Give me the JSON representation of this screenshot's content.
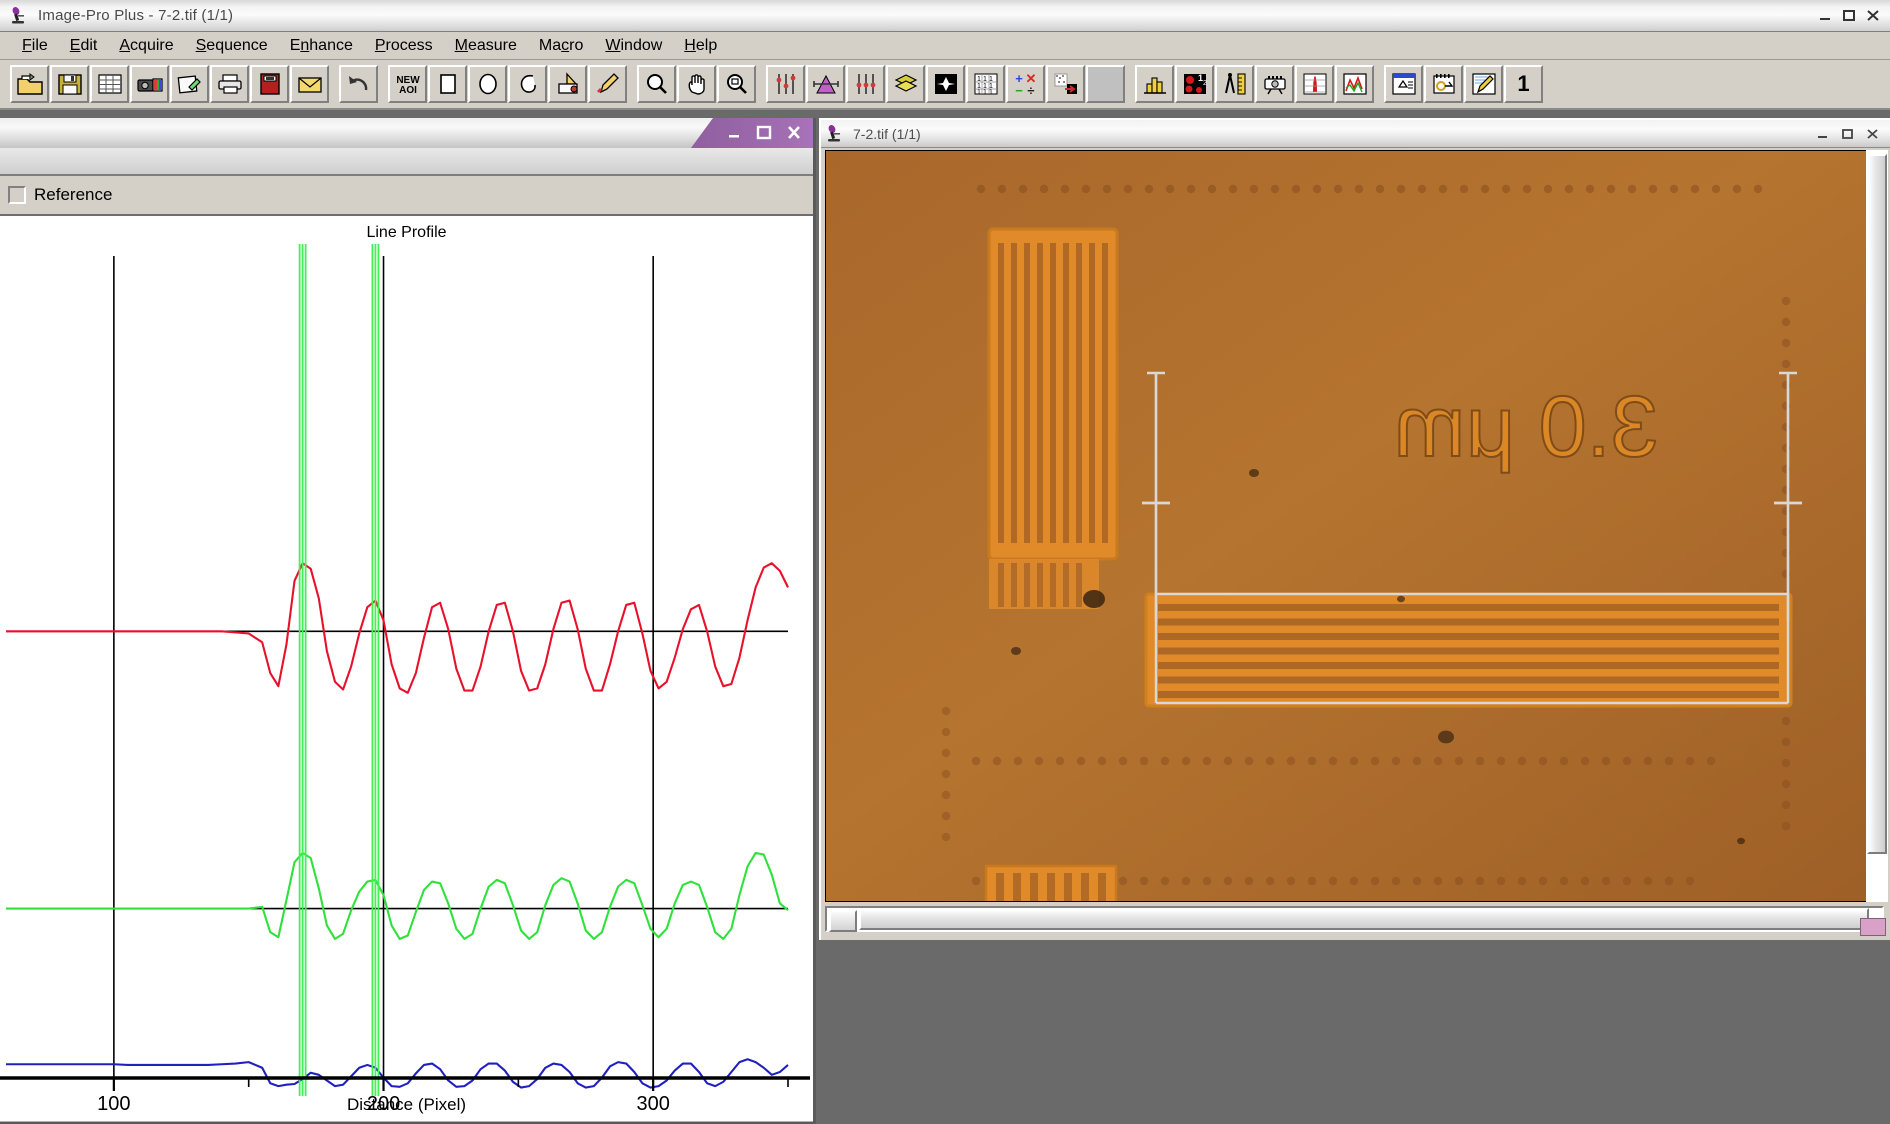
{
  "app": {
    "title": "Image-Pro Plus - 7-2.tif (1/1)",
    "icon": "microscope-icon",
    "window_controls": {
      "minimize": "–",
      "maximize": "□",
      "close": "✕"
    }
  },
  "menubar": {
    "items": [
      {
        "label": "File",
        "accel": "F"
      },
      {
        "label": "Edit",
        "accel": "E"
      },
      {
        "label": "Acquire",
        "accel": "A"
      },
      {
        "label": "Sequence",
        "accel": "S"
      },
      {
        "label": "Enhance",
        "accel": "n"
      },
      {
        "label": "Process",
        "accel": "P"
      },
      {
        "label": "Measure",
        "accel": "M"
      },
      {
        "label": "Macro",
        "accel": "c"
      },
      {
        "label": "Window",
        "accel": "W"
      },
      {
        "label": "Help",
        "accel": "H"
      }
    ]
  },
  "toolbar": {
    "groups": [
      {
        "buttons": [
          {
            "icon": "open-folder-icon",
            "label": "Open"
          },
          {
            "icon": "floppy-save-icon",
            "label": "Save"
          },
          {
            "icon": "grid-table-icon",
            "label": "Data Table"
          },
          {
            "icon": "camera-capture-icon",
            "label": "Capture"
          },
          {
            "icon": "paste-clipboard-icon",
            "label": "Paste"
          },
          {
            "icon": "printer-icon",
            "label": "Print"
          },
          {
            "icon": "book-red-icon",
            "label": "Album"
          },
          {
            "icon": "mail-envelope-icon",
            "label": "Send Mail"
          }
        ]
      },
      {
        "buttons": [
          {
            "icon": "undo-arrow-icon",
            "label": "Undo"
          }
        ]
      },
      {
        "buttons": [
          {
            "icon": "new-aoi-icon",
            "label": "NEW AOI"
          },
          {
            "icon": "rect-aoi-icon",
            "label": "Rectangle AOI"
          },
          {
            "icon": "ellipse-aoi-icon",
            "label": "Ellipse AOI"
          },
          {
            "icon": "freehand-aoi-icon",
            "label": "Freehand AOI"
          },
          {
            "icon": "mask-aoi-icon",
            "label": "AOI Mask"
          },
          {
            "icon": "pencil-draw-icon",
            "label": "Draw"
          }
        ]
      },
      {
        "buttons": [
          {
            "icon": "zoom-magnifier-icon",
            "label": "Zoom"
          },
          {
            "icon": "pan-hand-icon",
            "label": "Pan"
          },
          {
            "icon": "zoom-select-icon",
            "label": "Zoom Select"
          }
        ]
      },
      {
        "buttons": [
          {
            "icon": "contrast-sliders-icon",
            "label": "Contrast Enhance"
          },
          {
            "icon": "histogram-peak-icon",
            "label": "Histogram"
          },
          {
            "icon": "color-sliders-icon",
            "label": "Color Adjust"
          },
          {
            "icon": "layers-stack-icon",
            "label": "Layers"
          },
          {
            "icon": "filter-kernel-icon",
            "label": "Filters"
          },
          {
            "icon": "matrix-numbers-icon",
            "label": "Kernel Matrix"
          },
          {
            "icon": "math-operations-icon",
            "label": "Image Math"
          },
          {
            "icon": "segmentation-icon",
            "label": "Segmentation"
          },
          {
            "icon": "blank-gray-icon",
            "label": "Blank"
          }
        ]
      },
      {
        "buttons": [
          {
            "icon": "bar-chart-icon",
            "label": "Measurements"
          },
          {
            "icon": "count-size-icon",
            "label": "Count / Size"
          },
          {
            "icon": "caliper-ruler-icon",
            "label": "Caliper"
          },
          {
            "icon": "camera-tripod-icon",
            "label": "Snap"
          },
          {
            "icon": "intensity-peak-icon",
            "label": "Intensity"
          },
          {
            "icon": "line-profile-icon",
            "label": "Line Profile"
          }
        ]
      },
      {
        "buttons": [
          {
            "icon": "macro-window-icon",
            "label": "Macro"
          },
          {
            "icon": "macro-record-icon",
            "label": "Record Macro"
          },
          {
            "icon": "annotate-pen-icon",
            "label": "Annotate"
          },
          {
            "icon": "page-one-icon",
            "label": "1"
          }
        ]
      }
    ],
    "page_number": "1"
  },
  "line_profile_window": {
    "title": "",
    "window_controls": {
      "minimize": "–",
      "maximize": "□",
      "close": "✕"
    },
    "reference_checkbox": {
      "label": "Reference",
      "checked": false
    },
    "chart_title": "Line Profile",
    "x_axis_label": "Distance (Pixel)"
  },
  "image_window": {
    "title": "7-2.tif (1/1)",
    "icon": "microscope-icon",
    "window_controls": {
      "minimize": "–",
      "maximize": "□",
      "close": "✕"
    },
    "specimen_label": "3.0 μm",
    "scrollbars": {
      "horizontal": true,
      "vertical": true
    }
  },
  "colors": {
    "red_channel": "#e8112b",
    "green_channel": "#2fe13a",
    "blue_channel": "#2020c0",
    "marker_line": "#44ee55",
    "axis": "#000000",
    "window_face": "#d4d0c8",
    "titlebar_accent": "#9d6aad",
    "desktop": "#6a6a6a",
    "specimen_base": "#b0702e",
    "specimen_trace": "#e08a2a"
  },
  "chart_data": {
    "type": "line",
    "title": "Line Profile",
    "xlabel": "Distance (Pixel)",
    "ylabel": "",
    "xlim": [
      60,
      350
    ],
    "ylim": [
      0,
      255
    ],
    "grid": false,
    "xticks": [
      100,
      200,
      300
    ],
    "xticklabels": [
      "100",
      "200",
      "300"
    ],
    "legend": "none",
    "annotations": [
      {
        "type": "vertical-marker",
        "x": 170,
        "color": "#44ee55",
        "label": "cursor-marker-1"
      },
      {
        "type": "vertical-marker",
        "x": 197,
        "color": "#44ee55",
        "label": "cursor-marker-2"
      },
      {
        "type": "vertical-axis-line",
        "x": 100,
        "color": "#000000"
      },
      {
        "type": "vertical-axis-line",
        "x": 200,
        "color": "#000000"
      },
      {
        "type": "vertical-axis-line",
        "x": 300,
        "color": "#000000"
      }
    ],
    "series": [
      {
        "name": "Red",
        "color": "#e8112b",
        "baseline": 150,
        "x": [
          60,
          65,
          70,
          75,
          80,
          85,
          90,
          95,
          100,
          105,
          110,
          115,
          120,
          125,
          130,
          135,
          140,
          145,
          150,
          155,
          158,
          161,
          164,
          167,
          170,
          173,
          176,
          179,
          182,
          185,
          188,
          191,
          194,
          197,
          200,
          203,
          206,
          209,
          212,
          215,
          218,
          221,
          224,
          227,
          230,
          233,
          236,
          239,
          242,
          245,
          248,
          251,
          254,
          257,
          260,
          263,
          266,
          269,
          272,
          275,
          278,
          281,
          284,
          287,
          290,
          293,
          296,
          299,
          302,
          305,
          308,
          311,
          314,
          317,
          320,
          323,
          326,
          329,
          332,
          335,
          338,
          341,
          344,
          347,
          350
        ],
        "y": [
          150,
          150,
          150,
          150,
          150,
          150,
          150,
          150,
          150,
          150,
          150,
          150,
          150,
          150,
          150,
          150,
          150,
          149,
          148,
          140,
          112,
          100,
          138,
          196,
          212,
          207,
          180,
          132,
          104,
          97,
          118,
          148,
          172,
          178,
          160,
          120,
          98,
          94,
          112,
          144,
          172,
          176,
          152,
          116,
          96,
          96,
          118,
          150,
          174,
          176,
          150,
          114,
          96,
          98,
          120,
          152,
          176,
          178,
          152,
          116,
          96,
          96,
          120,
          150,
          174,
          176,
          148,
          114,
          98,
          104,
          126,
          152,
          170,
          174,
          150,
          118,
          100,
          102,
          126,
          160,
          190,
          208,
          212,
          205,
          190
        ]
      },
      {
        "name": "Green",
        "color": "#2fe13a",
        "baseline": 80,
        "x": [
          60,
          65,
          70,
          75,
          80,
          85,
          90,
          95,
          100,
          105,
          110,
          115,
          120,
          125,
          130,
          135,
          140,
          145,
          150,
          155,
          158,
          161,
          164,
          167,
          170,
          173,
          176,
          179,
          182,
          185,
          188,
          191,
          194,
          197,
          200,
          203,
          206,
          209,
          212,
          215,
          218,
          221,
          224,
          227,
          230,
          233,
          236,
          239,
          242,
          245,
          248,
          251,
          254,
          257,
          260,
          263,
          266,
          269,
          272,
          275,
          278,
          281,
          284,
          287,
          290,
          293,
          296,
          299,
          302,
          305,
          308,
          311,
          314,
          317,
          320,
          323,
          326,
          329,
          332,
          335,
          338,
          341,
          344,
          347,
          350
        ],
        "y": [
          80,
          80,
          80,
          80,
          80,
          80,
          80,
          80,
          80,
          80,
          80,
          80,
          80,
          80,
          80,
          80,
          80,
          80,
          80,
          82,
          52,
          46,
          90,
          135,
          146,
          140,
          104,
          60,
          44,
          50,
          78,
          100,
          112,
          114,
          96,
          60,
          44,
          48,
          76,
          102,
          112,
          110,
          86,
          56,
          44,
          50,
          80,
          106,
          114,
          110,
          84,
          54,
          44,
          52,
          84,
          108,
          116,
          112,
          86,
          54,
          44,
          52,
          82,
          106,
          114,
          110,
          84,
          56,
          46,
          56,
          86,
          108,
          112,
          108,
          82,
          52,
          44,
          56,
          96,
          130,
          146,
          144,
          120,
          86,
          78
        ]
      },
      {
        "name": "Blue",
        "color": "#2020c0",
        "baseline": 45,
        "x": [
          60,
          65,
          70,
          75,
          80,
          85,
          90,
          95,
          100,
          105,
          110,
          115,
          120,
          125,
          130,
          135,
          140,
          145,
          150,
          155,
          158,
          161,
          164,
          167,
          170,
          173,
          176,
          179,
          182,
          185,
          188,
          191,
          194,
          197,
          200,
          203,
          206,
          209,
          212,
          215,
          218,
          221,
          224,
          227,
          230,
          233,
          236,
          239,
          242,
          245,
          248,
          251,
          254,
          257,
          260,
          263,
          266,
          269,
          272,
          275,
          278,
          281,
          284,
          287,
          290,
          293,
          296,
          299,
          302,
          305,
          308,
          311,
          314,
          317,
          320,
          323,
          326,
          329,
          332,
          335,
          338,
          341,
          344,
          347,
          350
        ],
        "y": [
          45,
          45,
          45,
          45,
          45,
          45,
          45,
          45,
          45,
          44,
          44,
          44,
          44,
          44,
          44,
          44,
          45,
          46,
          48,
          40,
          18,
          14,
          16,
          17,
          24,
          33,
          30,
          22,
          14,
          16,
          28,
          40,
          44,
          40,
          26,
          14,
          13,
          18,
          32,
          44,
          46,
          38,
          22,
          13,
          14,
          22,
          38,
          46,
          46,
          36,
          20,
          12,
          14,
          24,
          40,
          46,
          44,
          34,
          18,
          12,
          14,
          26,
          42,
          48,
          46,
          34,
          18,
          12,
          14,
          22,
          36,
          46,
          46,
          34,
          18,
          14,
          20,
          34,
          48,
          52,
          48,
          40,
          30,
          34,
          44
        ]
      }
    ]
  }
}
